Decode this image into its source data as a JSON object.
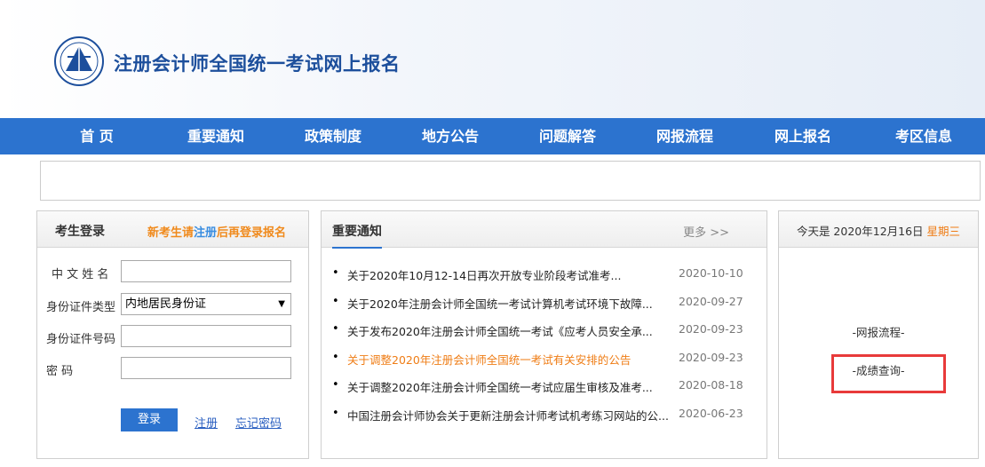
{
  "header": {
    "title": "注册会计师全国统一考试网上报名"
  },
  "nav": [
    "首 页",
    "重要通知",
    "政策制度",
    "地方公告",
    "问题解答",
    "网报流程",
    "网上报名",
    "考区信息"
  ],
  "login": {
    "title": "考生登录",
    "hint_pre": "新考生请",
    "hint_link": "注册",
    "hint_post": "后再登录报名",
    "name_label": "中 文  姓 名",
    "idtype_label": "身份证件类型",
    "idtype_value": "内地居民身份证",
    "idnum_label": "身份证件号码",
    "password_label": "密        码",
    "login_button": "登录",
    "register_link": "注册",
    "forgot_link": "忘记密码"
  },
  "notice": {
    "title": "重要通知",
    "more": "更多 >>",
    "items": [
      {
        "title": "关于2020年10月12-14日再次开放专业阶段考试准考...",
        "date": "2020-10-10"
      },
      {
        "title": "关于2020年注册会计师全国统一考试计算机考试环境下故障...",
        "date": "2020-09-27"
      },
      {
        "title": "关于发布2020年注册会计师全国统一考试《应考人员安全承...",
        "date": "2020-09-23"
      },
      {
        "title": "关于调整2020年注册会计师全国统一考试有关安排的公告",
        "date": "2020-09-23"
      },
      {
        "title": "关于调整2020年注册会计师全国统一考试应届生审核及准考...",
        "date": "2020-08-18"
      },
      {
        "title": "中国注册会计师协会关于更新注册会计师考试机考练习网站的公...",
        "date": "2020-06-23"
      }
    ]
  },
  "datebox": {
    "today_prefix": "今天是 2020年12月16日 ",
    "weekday": "星期三",
    "flow_link": "-网报流程-",
    "score_link": "-成绩查询-"
  },
  "colors": {
    "nav": "#2c73cf",
    "accent": "#ef7d16",
    "highlight": "#e83a3a"
  }
}
